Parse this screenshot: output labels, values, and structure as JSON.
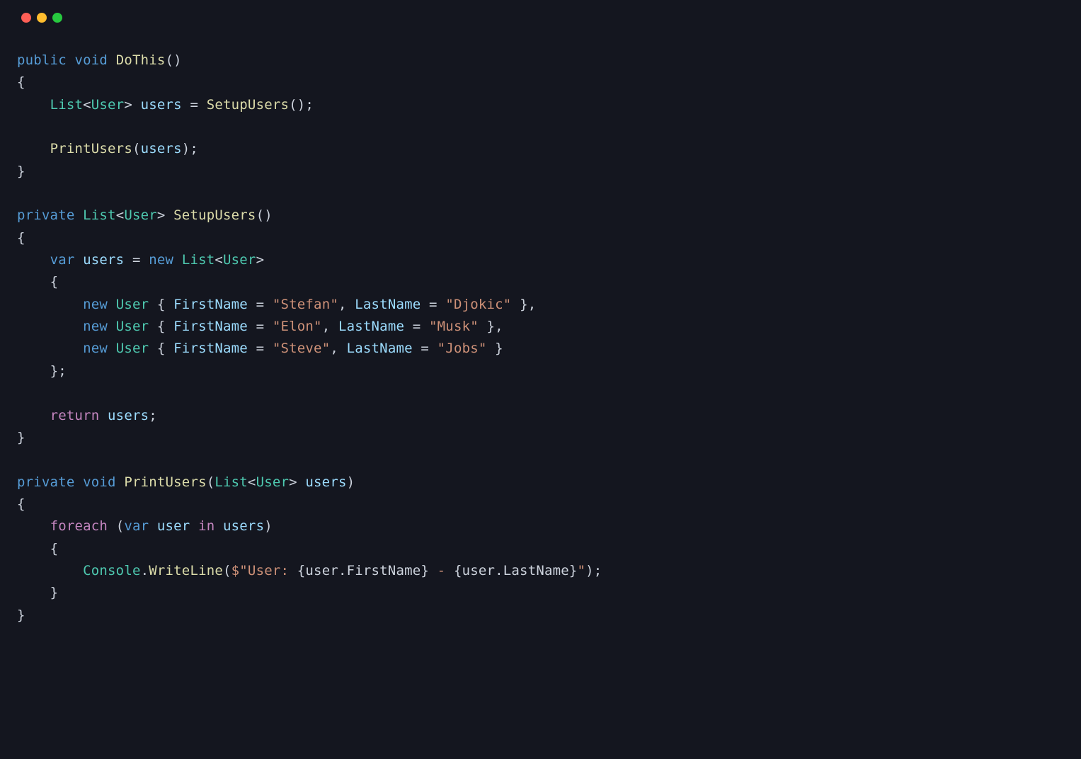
{
  "colors": {
    "background": "#14161f",
    "keyword_blue": "#569cd6",
    "type_green": "#4ec9b0",
    "method_yellow": "#dcdcaa",
    "variable_lightblue": "#9cdcfe",
    "string_orange": "#ce9178",
    "control_purple": "#c586c0",
    "default": "#cdd3dd"
  },
  "window_controls": {
    "close": "#ff5f56",
    "minimize": "#ffbd2e",
    "maximize": "#27c93f"
  },
  "tokens": {
    "public": "public",
    "private": "private",
    "void": "void",
    "var": "var",
    "new": "new",
    "return": "return",
    "foreach": "foreach",
    "in": "in",
    "List": "List",
    "User": "User",
    "DoThis": "DoThis",
    "SetupUsers": "SetupUsers",
    "PrintUsers": "PrintUsers",
    "WriteLine": "WriteLine",
    "Console": "Console",
    "users": "users",
    "user": "user",
    "FirstName": "FirstName",
    "LastName": "LastName",
    "str_stefan": "\"Stefan\"",
    "str_djokic": "\"Djokic\"",
    "str_elon": "\"Elon\"",
    "str_musk": "\"Musk\"",
    "str_steve": "\"Steve\"",
    "str_jobs": "\"Jobs\"",
    "interp_prefix": "$\"User: ",
    "interp_open1": "{user.FirstName}",
    "interp_mid": " - ",
    "interp_open2": "{user.LastName}",
    "interp_suffix": "\""
  }
}
